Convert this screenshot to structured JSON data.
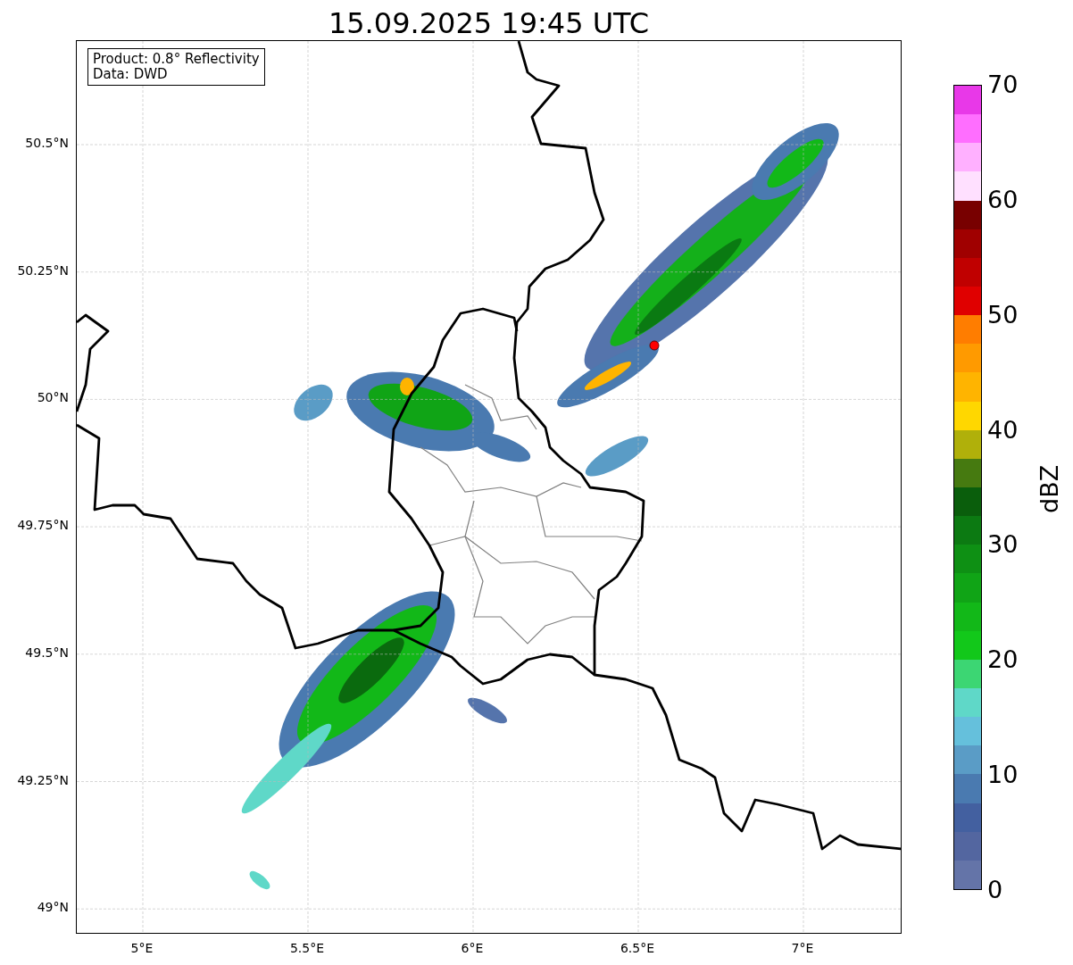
{
  "title": "15.09.2025 19:45 UTC",
  "info_box": {
    "lines": [
      "Product: 0.8° Reflectivity",
      "Data: DWD"
    ]
  },
  "y_axis": {
    "ticks": [
      "50.5°N",
      "50.25°N",
      "50°N",
      "49.75°N",
      "49.5°N",
      "49.25°N",
      "49°N"
    ]
  },
  "x_axis": {
    "ticks": [
      "5°E",
      "5.5°E",
      "6°E",
      "6.5°E",
      "7°E"
    ]
  },
  "colorbar": {
    "label": "dBZ",
    "ticks": [
      "70",
      "60",
      "50",
      "40",
      "30",
      "20",
      "10",
      "0"
    ],
    "segments": [
      {
        "color": "#e838e8"
      },
      {
        "color": "#ff6eff"
      },
      {
        "color": "#ffb0ff"
      },
      {
        "color": "#ffe0ff"
      },
      {
        "color": "#780000"
      },
      {
        "color": "#a00000"
      },
      {
        "color": "#c00000"
      },
      {
        "color": "#e00000"
      },
      {
        "color": "#ff7d00"
      },
      {
        "color": "#ff9a00"
      },
      {
        "color": "#ffb400"
      },
      {
        "color": "#ffd700"
      },
      {
        "color": "#b0b00a"
      },
      {
        "color": "#467a10"
      },
      {
        "color": "#0a5e0c"
      },
      {
        "color": "#0c7a12"
      },
      {
        "color": "#0e9014"
      },
      {
        "color": "#10a416"
      },
      {
        "color": "#12b818"
      },
      {
        "color": "#12c81a"
      },
      {
        "color": "#3cd673"
      },
      {
        "color": "#5fd8c8"
      },
      {
        "color": "#65c0dc"
      },
      {
        "color": "#5a9cc6"
      },
      {
        "color": "#4a7ab0"
      },
      {
        "color": "#4360a0"
      },
      {
        "color": "#5366a0"
      },
      {
        "color": "#6474a8"
      }
    ]
  }
}
